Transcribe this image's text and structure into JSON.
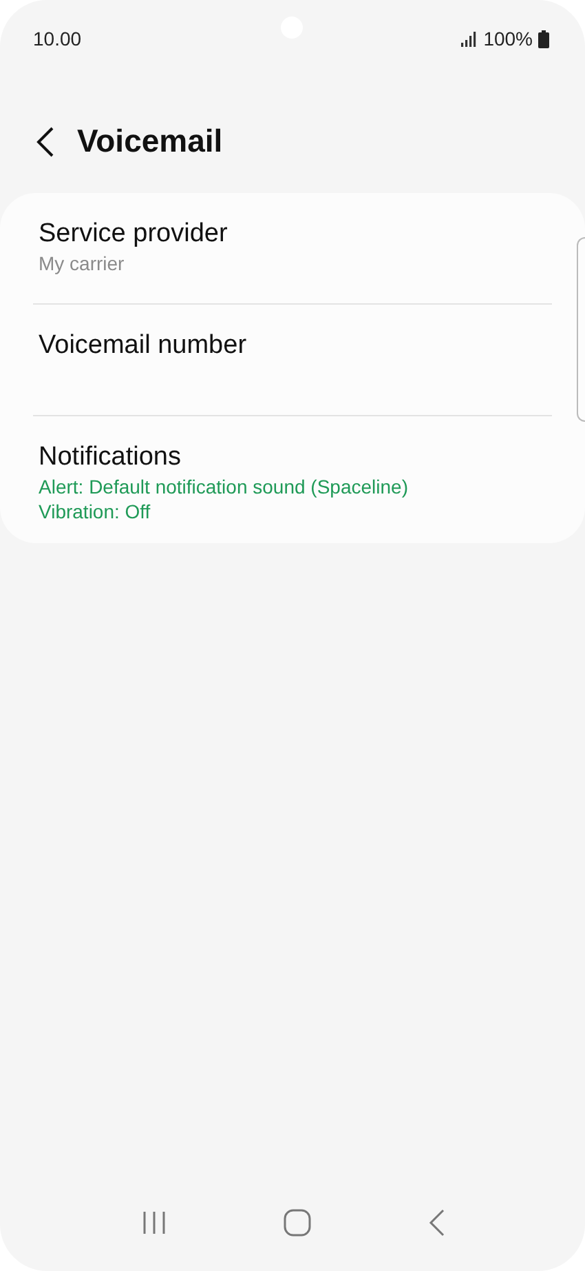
{
  "status_bar": {
    "time": "10.00",
    "battery": "100%"
  },
  "header": {
    "title": "Voicemail"
  },
  "items": [
    {
      "title": "Service provider",
      "kind": "muted",
      "lines": [
        "My carrier"
      ]
    },
    {
      "title": "Voicemail number",
      "kind": "empty"
    },
    {
      "title": "Notifications",
      "kind": "accent",
      "lines": [
        "Alert: Default notification sound (Spaceline)",
        "Vibration: Off"
      ]
    }
  ]
}
